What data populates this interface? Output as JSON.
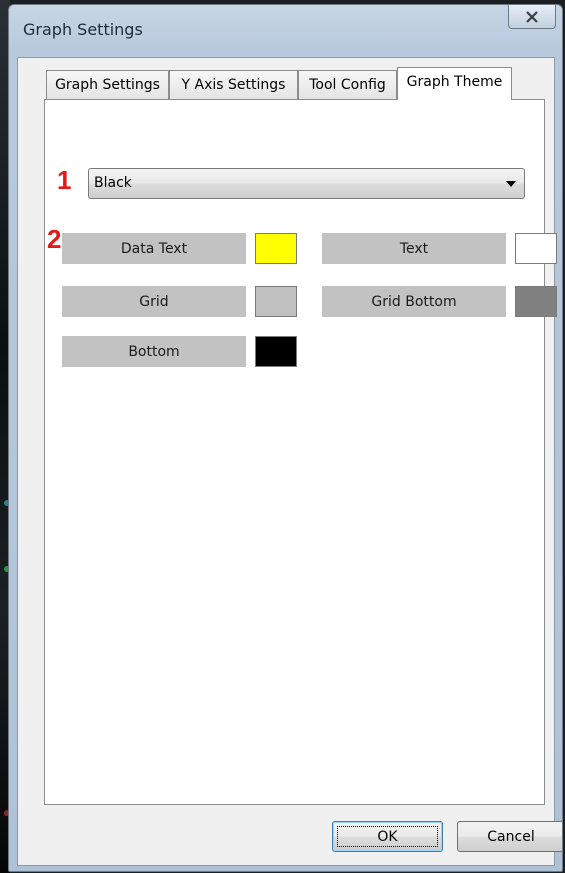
{
  "window": {
    "title": "Graph Settings",
    "close_label": "X"
  },
  "tabs": [
    {
      "label": "Graph Settings",
      "active": false
    },
    {
      "label": "Y Axis Settings",
      "active": false
    },
    {
      "label": "Tool Config",
      "active": false
    },
    {
      "label": "Graph Theme",
      "active": true
    }
  ],
  "annotations": [
    "1",
    "2"
  ],
  "theme_select": {
    "value": "Black"
  },
  "colors": {
    "data_text": {
      "label": "Data Text",
      "color": "#ffff00"
    },
    "text": {
      "label": "Text",
      "color": "#ffffff"
    },
    "grid": {
      "label": "Grid",
      "color": "#c0c0c0"
    },
    "grid_bottom": {
      "label": "Grid Bottom",
      "color": "#808080"
    },
    "bottom": {
      "label": "Bottom",
      "color": "#000000"
    }
  },
  "buttons": {
    "ok": "OK",
    "cancel": "Cancel"
  }
}
